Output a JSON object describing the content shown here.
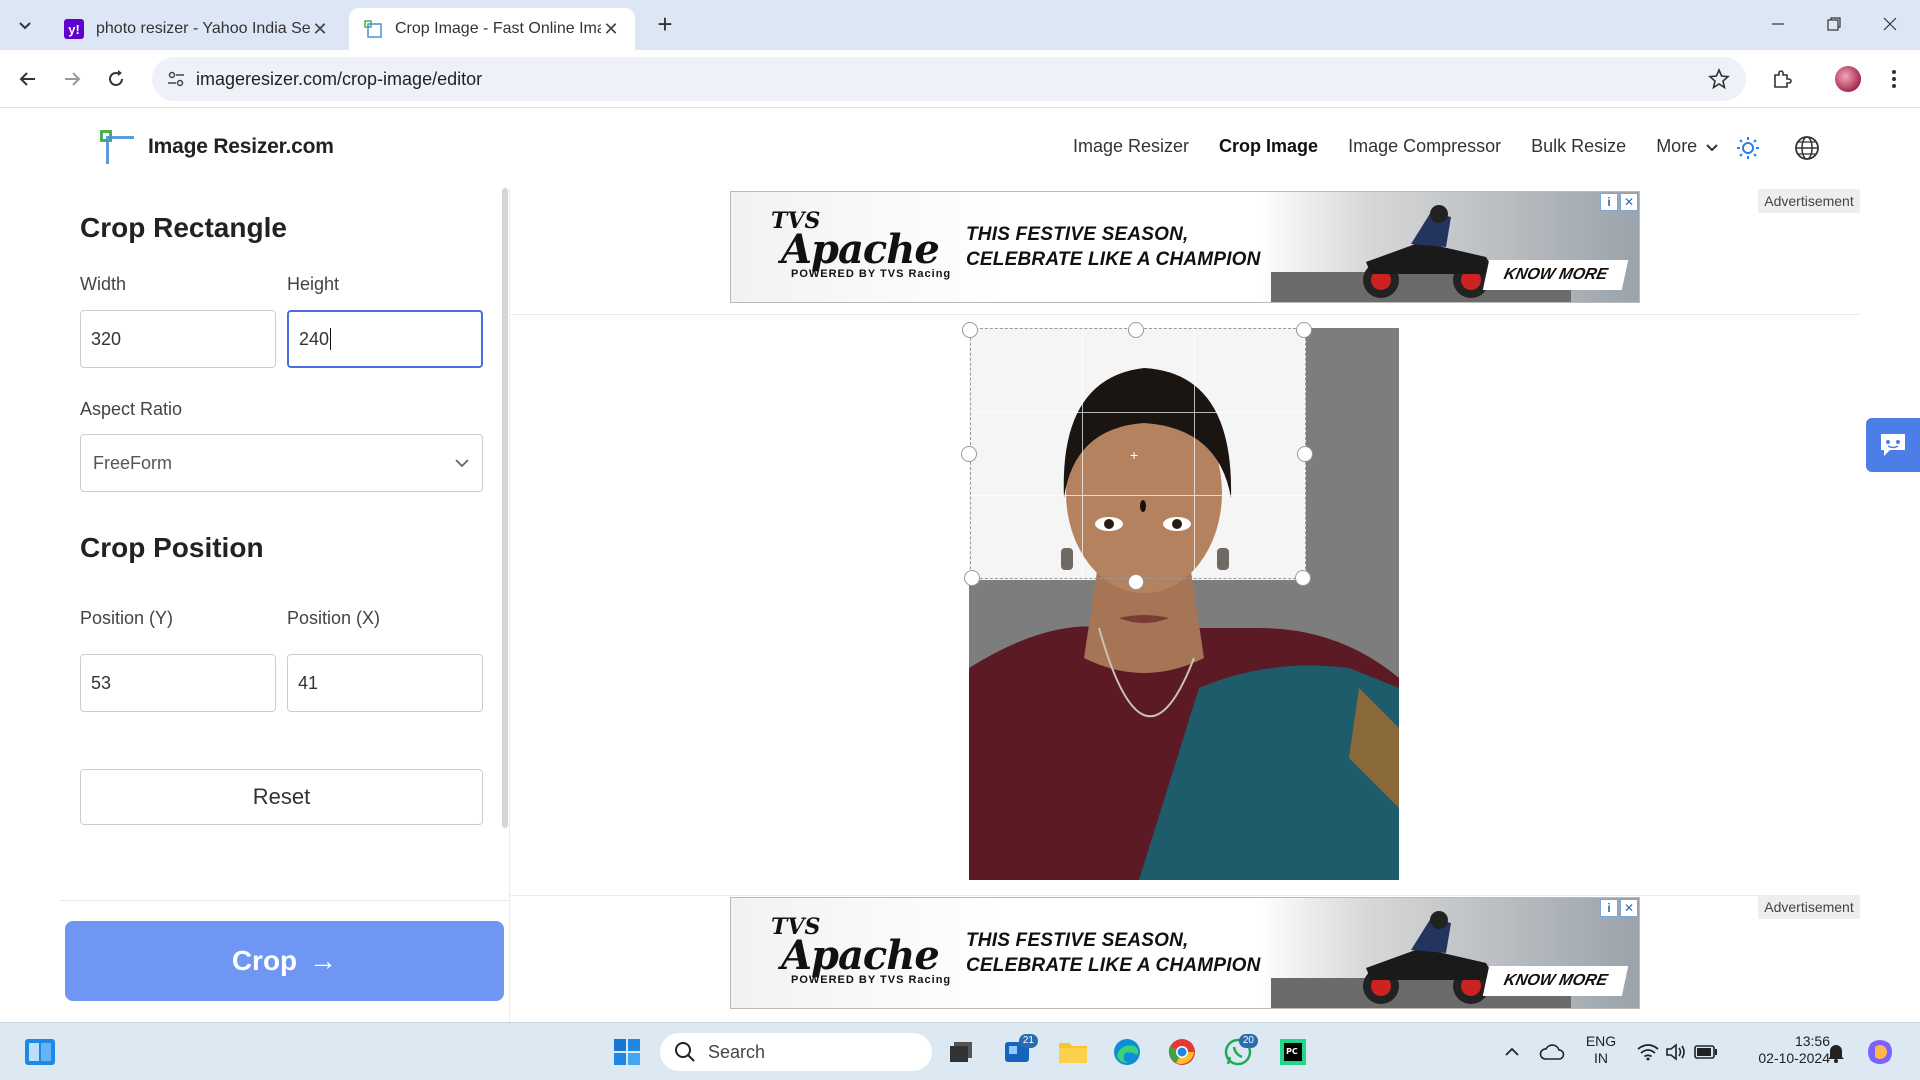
{
  "browser": {
    "tabs": [
      {
        "title": "photo resizer - Yahoo India Sea",
        "favicon": "yahoo-icon",
        "active": false
      },
      {
        "title": "Crop Image - Fast Online Image",
        "favicon": "imageresizer-icon",
        "active": true
      }
    ],
    "url": "imageresizer.com/crop-image/editor"
  },
  "site": {
    "logo_text": "Image Resizer.com",
    "nav": [
      "Image Resizer",
      "Crop Image",
      "Image Compressor",
      "Bulk Resize",
      "More"
    ],
    "active_nav": "Crop Image"
  },
  "panel": {
    "crop_rect_title": "Crop Rectangle",
    "width_label": "Width",
    "width_value": "320",
    "height_label": "Height",
    "height_value": "240",
    "aspect_label": "Aspect Ratio",
    "aspect_value": "FreeForm",
    "crop_pos_title": "Crop Position",
    "pos_y_label": "Position (Y)",
    "pos_y_value": "53",
    "pos_x_label": "Position (X)",
    "pos_x_value": "41",
    "reset_label": "Reset",
    "crop_label": "Crop",
    "crop_arrow": "→"
  },
  "ads": {
    "label": "Advertisement",
    "brand_line1": "TVS",
    "brand_line2": "Apache",
    "brand_line3": "POWERED BY TVS Racing",
    "headline_line1": "THIS FESTIVE SEASON,",
    "headline_line2": "CELEBRATE LIKE A CHAMPION",
    "cta": "KNOW MORE"
  },
  "taskbar": {
    "search_placeholder": "Search",
    "badge_widgets": "21",
    "badge_whatsapp": "20",
    "lang_line1": "ENG",
    "lang_line2": "IN",
    "time": "13:56",
    "date": "02-10-2024"
  },
  "colors": {
    "accent": "#6f96f2",
    "focus": "#4a6ee0",
    "chrome": "#dce6f4",
    "taskbar": "#dce9f2"
  }
}
